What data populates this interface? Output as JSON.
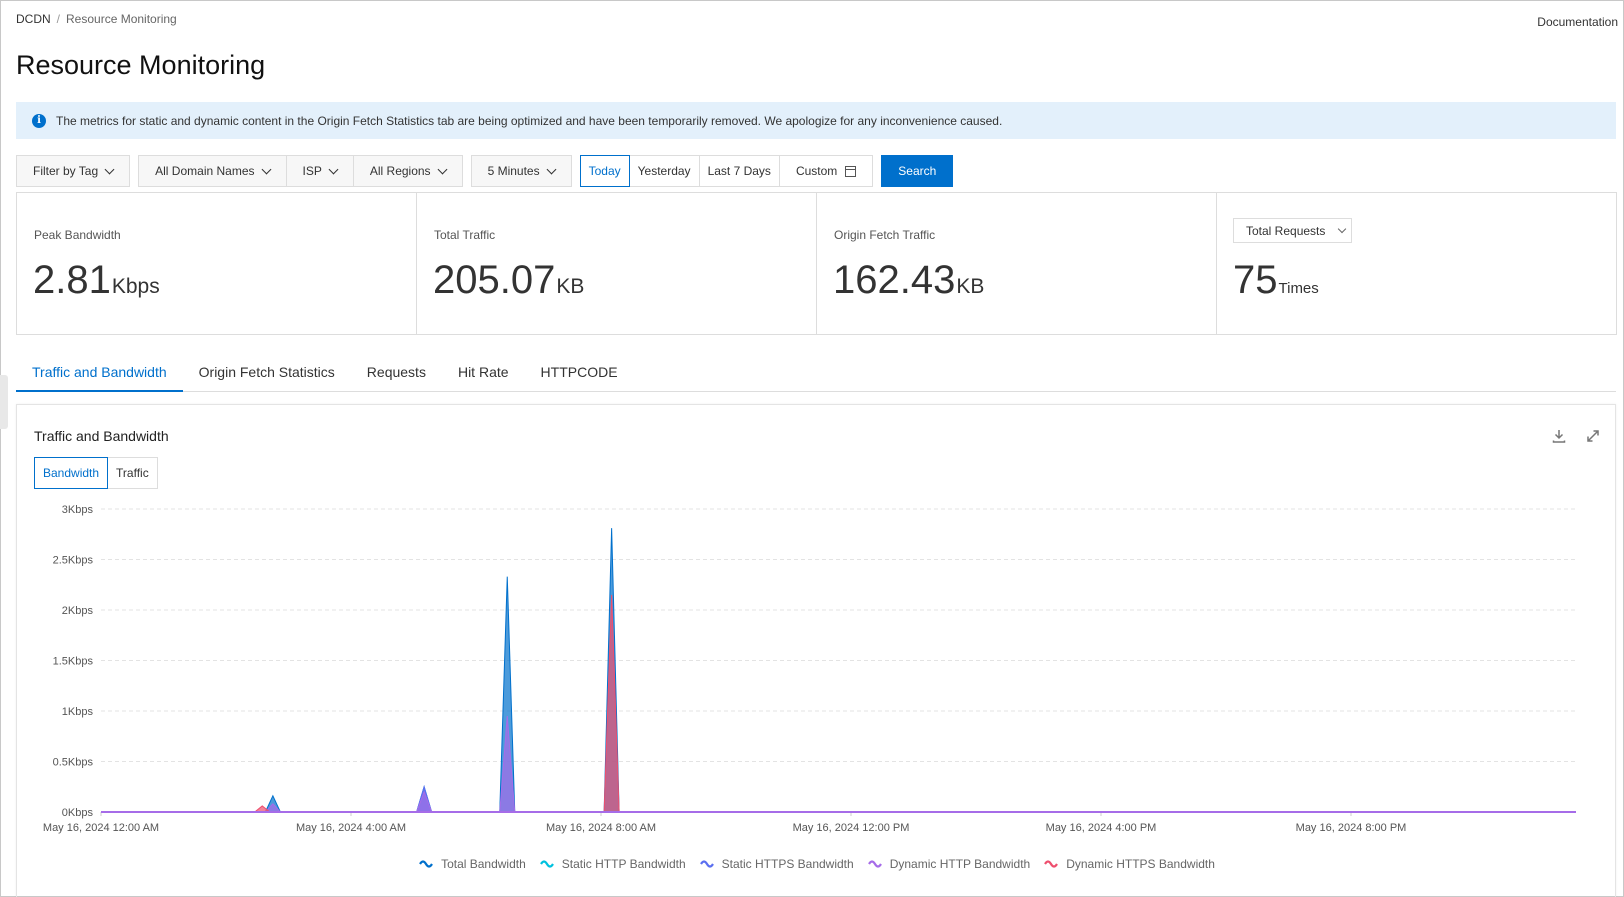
{
  "breadcrumb": {
    "root": "DCDN",
    "separator": "/",
    "current": "Resource Monitoring"
  },
  "header": {
    "documentation_link": "Documentation",
    "title": "Resource Monitoring"
  },
  "banner": {
    "icon": "info-icon",
    "message": "The metrics for static and dynamic content in the Origin Fetch Statistics tab are being optimized and have been temporarily removed. We apologize for any inconvenience caused."
  },
  "filters": {
    "tag": "Filter by Tag",
    "domain": "All Domain Names",
    "isp": "ISP",
    "region": "All Regions",
    "interval": "5 Minutes",
    "range_options": [
      "Today",
      "Yesterday",
      "Last 7 Days"
    ],
    "range_selected": "Today",
    "custom": "Custom",
    "search": "Search"
  },
  "cards": [
    {
      "label": "Peak Bandwidth",
      "value": "2.81",
      "unit": "Kbps"
    },
    {
      "label": "Total Traffic",
      "value": "205.07",
      "unit": "KB"
    },
    {
      "label": "Origin Fetch Traffic",
      "value": "162.43",
      "unit": "KB"
    },
    {
      "select": "Total Requests",
      "value": "75",
      "unit": "Times"
    }
  ],
  "tabs": [
    {
      "label": "Traffic and Bandwidth",
      "active": true
    },
    {
      "label": "Origin Fetch Statistics",
      "active": false
    },
    {
      "label": "Requests",
      "active": false
    },
    {
      "label": "Hit Rate",
      "active": false
    },
    {
      "label": "HTTPCODE",
      "active": false
    }
  ],
  "panel": {
    "title": "Traffic and Bandwidth",
    "toggle": [
      "Bandwidth",
      "Traffic"
    ],
    "toggle_selected": "Bandwidth",
    "icons": [
      "download-icon",
      "expand-icon"
    ]
  },
  "chart_data": {
    "type": "area",
    "title": "Traffic and Bandwidth",
    "xlabel": "",
    "ylabel": "",
    "x_unit": "hours since May 16, 2024 12:00 AM",
    "xlim": [
      0,
      23.6
    ],
    "ylim": [
      0,
      3
    ],
    "y_ticks": [
      "0Kbps",
      "0.5Kbps",
      "1Kbps",
      "1.5Kbps",
      "2Kbps",
      "2.5Kbps",
      "3Kbps"
    ],
    "y_tick_values": [
      0,
      0.5,
      1,
      1.5,
      2,
      2.5,
      3
    ],
    "x_ticks": [
      "May 16, 2024 12:00 AM",
      "May 16, 2024 4:00 AM",
      "May 16, 2024 8:00 AM",
      "May 16, 2024 12:00 PM",
      "May 16, 2024 4:00 PM",
      "May 16, 2024 8:00 PM"
    ],
    "x_tick_values": [
      0,
      4,
      8,
      12,
      16,
      20
    ],
    "grid": true,
    "legend_position": "bottom",
    "series": [
      {
        "name": "Total Bandwidth",
        "color": "#0070cc",
        "peaks": [
          [
            2.75,
            0.16
          ],
          [
            5.17,
            0.25
          ],
          [
            6.5,
            2.33
          ],
          [
            8.17,
            2.81
          ]
        ]
      },
      {
        "name": "Static HTTP Bandwidth",
        "color": "#00c1de",
        "peaks": []
      },
      {
        "name": "Static HTTPS Bandwidth",
        "color": "#5b6ff0",
        "peaks": [
          [
            5.17,
            0.25
          ]
        ]
      },
      {
        "name": "Dynamic HTTP Bandwidth",
        "color": "#a66ce8",
        "peaks": [
          [
            2.75,
            0.08
          ],
          [
            5.17,
            0.2
          ],
          [
            6.5,
            0.95
          ]
        ]
      },
      {
        "name": "Dynamic HTTPS Bandwidth",
        "color": "#ee4f6e",
        "peaks": [
          [
            2.58,
            0.06
          ],
          [
            8.17,
            2.15
          ]
        ]
      }
    ]
  }
}
